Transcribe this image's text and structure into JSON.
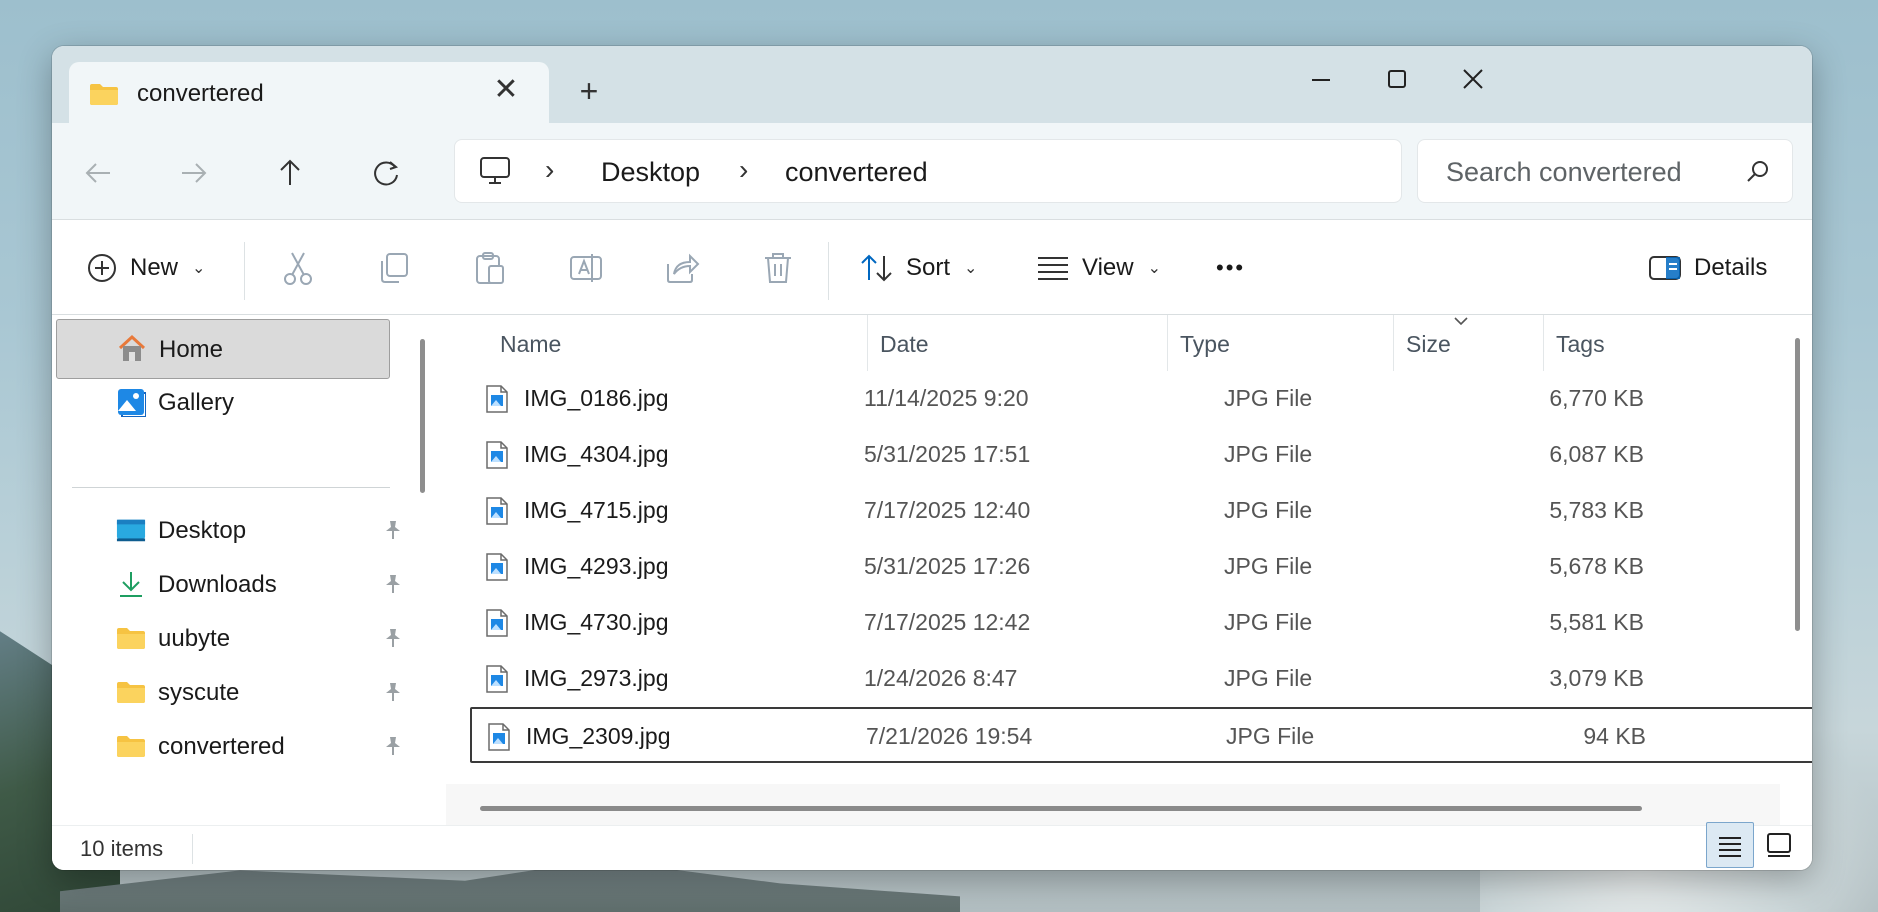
{
  "window": {
    "tab_title": "convertered",
    "tab_icon": "folder-icon",
    "controls": [
      "minimize-icon",
      "maximize-icon",
      "close-icon"
    ]
  },
  "address": {
    "root_icon": "this-pc-icon",
    "crumbs": [
      "Desktop",
      "convertered"
    ],
    "search_placeholder": "Search convertered"
  },
  "commands": {
    "new_label": "New",
    "sort_label": "Sort",
    "view_label": "View",
    "more_label": "•••",
    "details_label": "Details"
  },
  "sidebar": {
    "items": [
      {
        "label": "Home",
        "icon": "home-icon",
        "selected": true,
        "pinned": false
      },
      {
        "label": "Gallery",
        "icon": "gallery-icon",
        "selected": false,
        "pinned": false
      },
      {
        "label": "Desktop",
        "icon": "desktop-icon",
        "selected": false,
        "pinned": true
      },
      {
        "label": "Downloads",
        "icon": "download-icon",
        "selected": false,
        "pinned": true
      },
      {
        "label": "uubyte",
        "icon": "folder-icon",
        "selected": false,
        "pinned": true
      },
      {
        "label": "syscute",
        "icon": "folder-icon",
        "selected": false,
        "pinned": true
      },
      {
        "label": "convertered",
        "icon": "folder-icon",
        "selected": false,
        "pinned": true
      }
    ]
  },
  "table": {
    "columns": [
      "Name",
      "Date",
      "Type",
      "Size",
      "Tags"
    ],
    "sorted_column": "Size",
    "rows": [
      {
        "name": "IMG_0186.jpg",
        "date": "11/14/2025 9:20",
        "type": "JPG File",
        "size": "6,770 KB",
        "selected": false
      },
      {
        "name": "IMG_4304.jpg",
        "date": "5/31/2025 17:51",
        "type": "JPG File",
        "size": "6,087 KB",
        "selected": false
      },
      {
        "name": "IMG_4715.jpg",
        "date": "7/17/2025 12:40",
        "type": "JPG File",
        "size": "5,783 KB",
        "selected": false
      },
      {
        "name": "IMG_4293.jpg",
        "date": "5/31/2025 17:26",
        "type": "JPG File",
        "size": "5,678 KB",
        "selected": false
      },
      {
        "name": "IMG_4730.jpg",
        "date": "7/17/2025 12:42",
        "type": "JPG File",
        "size": "5,581 KB",
        "selected": false
      },
      {
        "name": "IMG_2973.jpg",
        "date": "1/24/2026 8:47",
        "type": "JPG File",
        "size": "3,079 KB",
        "selected": false
      },
      {
        "name": "IMG_2309.jpg",
        "date": "7/21/2026 19:54",
        "type": "JPG File",
        "size": "94 KB",
        "selected": true
      }
    ]
  },
  "status": {
    "item_count": "10 items",
    "view_modes": [
      "details-view-icon",
      "tiles-view-icon"
    ],
    "active_view": "details-view-icon"
  },
  "colors": {
    "titlebar": "#d4e1e6",
    "toolbar": "#f1f6f8",
    "accent": "#0067c0",
    "folder": "#f6c342",
    "home": "#e8793a"
  }
}
